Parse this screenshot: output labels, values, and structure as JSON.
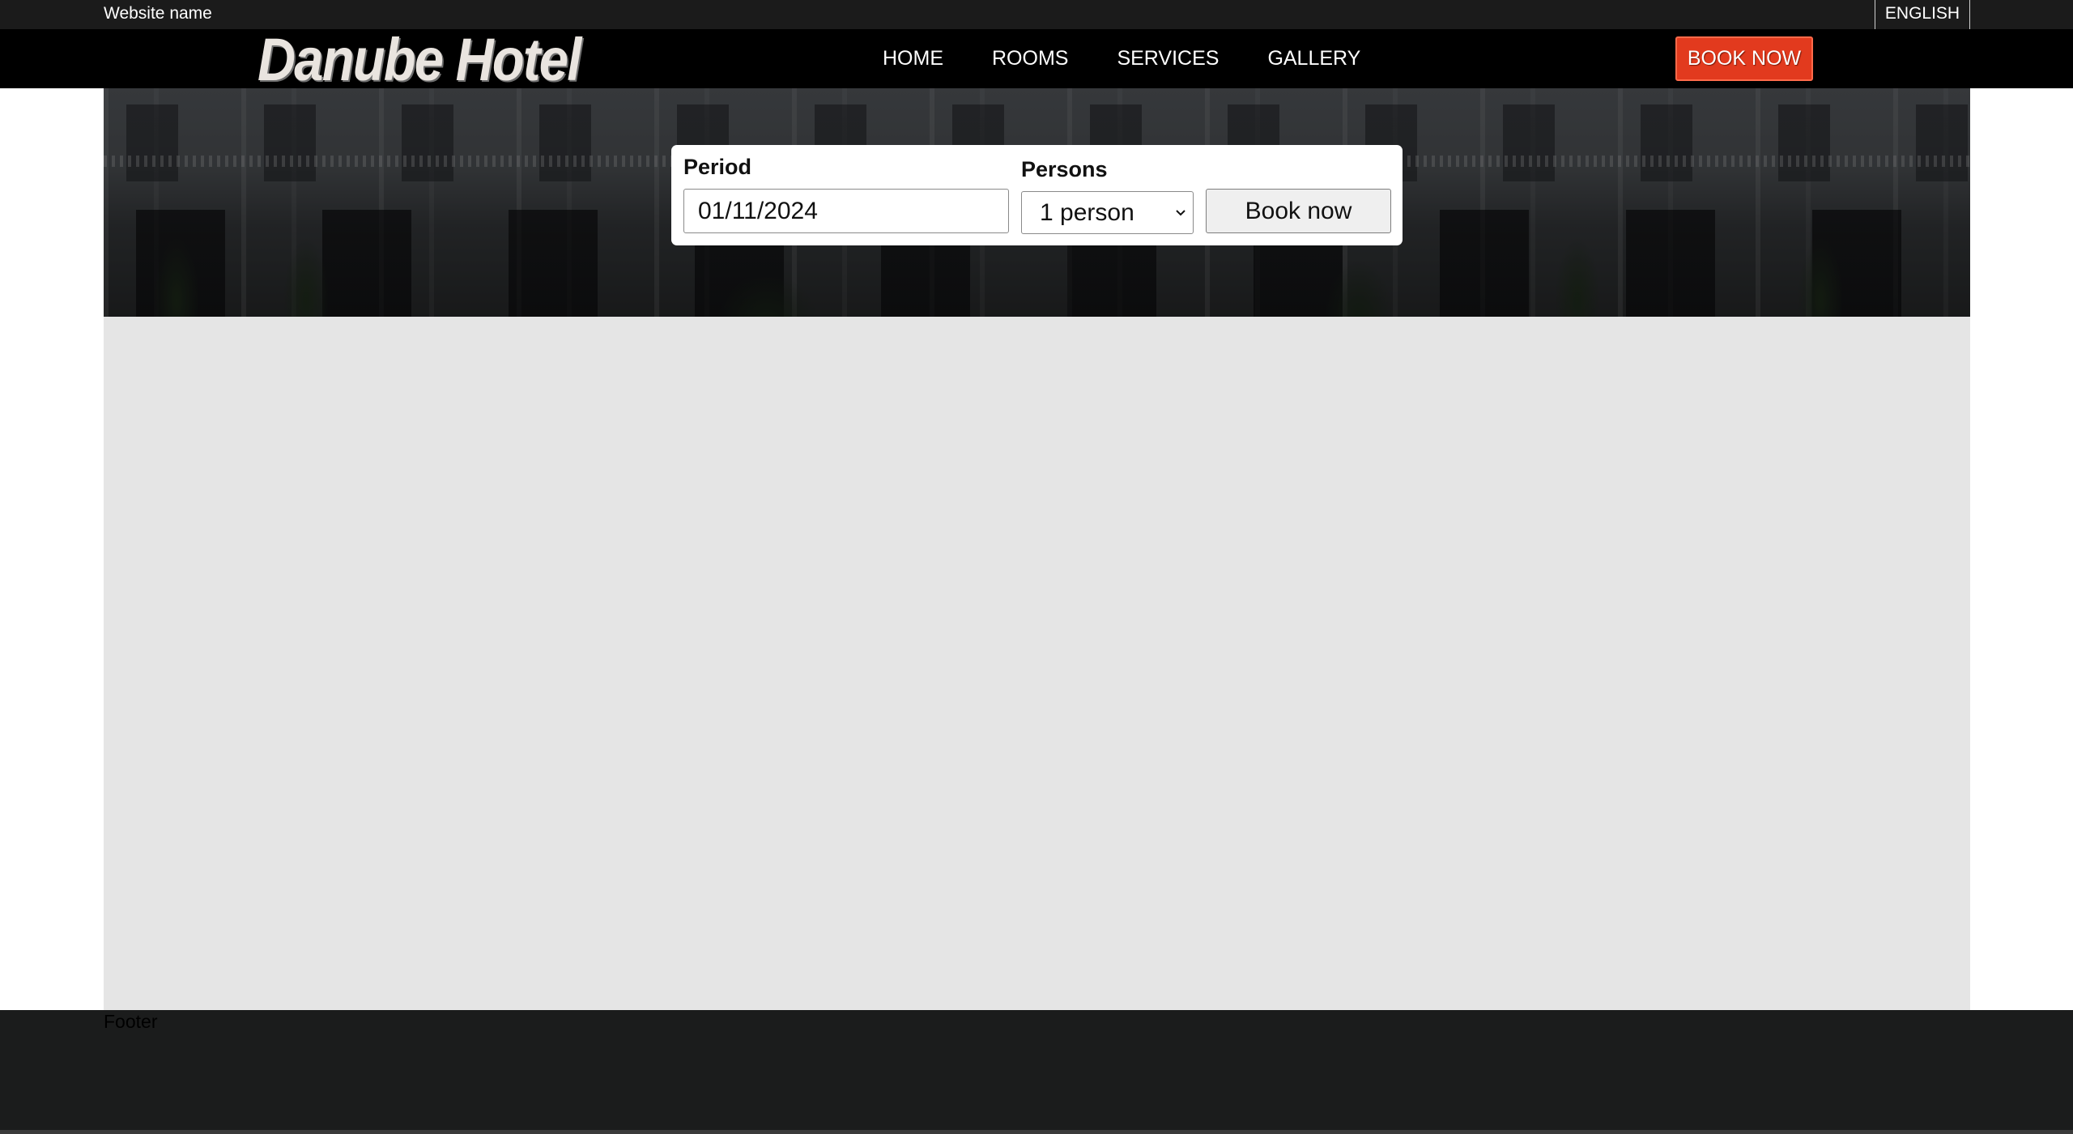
{
  "topbar": {
    "site_name": "Website name",
    "language": "ENGLISH"
  },
  "navbar": {
    "logo_text": "Danube Hotel",
    "links": [
      {
        "label": "HOME"
      },
      {
        "label": "ROOMS"
      },
      {
        "label": "SERVICES"
      },
      {
        "label": "GALLERY"
      }
    ],
    "book_label": "BOOK NOW"
  },
  "booking": {
    "period_label": "Period",
    "period_value": "01/11/2024",
    "persons_label": "Persons",
    "persons_value": "1 person",
    "submit_label": "Book now"
  },
  "footer": {
    "text": "Footer"
  },
  "colors": {
    "accent": "#e23a1e",
    "topbar": "#1b1b1b",
    "navbar": "#000000",
    "content_bg": "#e5e5e5",
    "footer_bg": "#1b1c1c"
  },
  "icons": {
    "select_arrow": "chevron-down-icon"
  }
}
